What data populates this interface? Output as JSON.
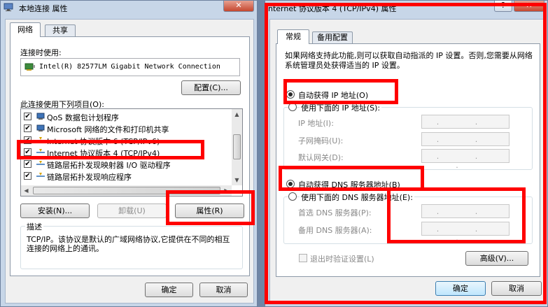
{
  "left_dialog": {
    "title": "本地连接 属性",
    "tabs": [
      "网络",
      "共享"
    ],
    "connect_using_label": "连接时使用:",
    "adapter_name": "Intel(R) 82577LM Gigabit Network Connection",
    "configure_button": "配置(C)...",
    "items_label": "此连接使用下列项目(O):",
    "items": [
      {
        "label": "QoS 数据包计划程序",
        "checked": true
      },
      {
        "label": "Microsoft 网络的文件和打印机共享",
        "checked": true
      },
      {
        "label": "Internet 协议版本 6 (TCP/IPv6)",
        "checked": true
      },
      {
        "label": "Internet 协议版本 4 (TCP/IPv4)",
        "checked": true
      },
      {
        "label": "链路层拓扑发现映射器 I/O 驱动程序",
        "checked": true
      },
      {
        "label": "链路层拓扑发现响应程序",
        "checked": true
      }
    ],
    "install_button": "安装(N)...",
    "uninstall_button": "卸载(U)",
    "properties_button": "属性(R)",
    "description_title": "描述",
    "description_text": "TCP/IP。该协议是默认的广域网络协议,它提供在不同的相互连接的网络上的通讯。",
    "ok_button": "确定",
    "cancel_button": "取消"
  },
  "right_dialog": {
    "title": "nternet 协议版本 4 (TCP/IPv4) 属性",
    "tabs": [
      "常规",
      "备用配置"
    ],
    "intro": "如果网络支持此功能,则可以获取自动指派的 IP 设置。否则,您需要从网络系统管理员处获得适当的 IP 设置。",
    "auto_ip": "自动获得 IP 地址(O)",
    "manual_ip": "使用下面的 IP 地址(S):",
    "ip_label": "IP 地址(I):",
    "subnet_label": "子网掩码(U):",
    "gateway_label": "默认网关(D):",
    "auto_dns": "自动获得 DNS 服务器地址(B)",
    "manual_dns": "使用下面的 DNS 服务器地址(E):",
    "preferred_dns_label": "首选 DNS 服务器(P):",
    "alternate_dns_label": "备用 DNS 服务器(A):",
    "validate_label": "退出时验证设置(L)",
    "advanced_button": "高级(V)...",
    "ok_button": "确定",
    "cancel_button": "取消",
    "ip_placeholder": ". . ."
  }
}
